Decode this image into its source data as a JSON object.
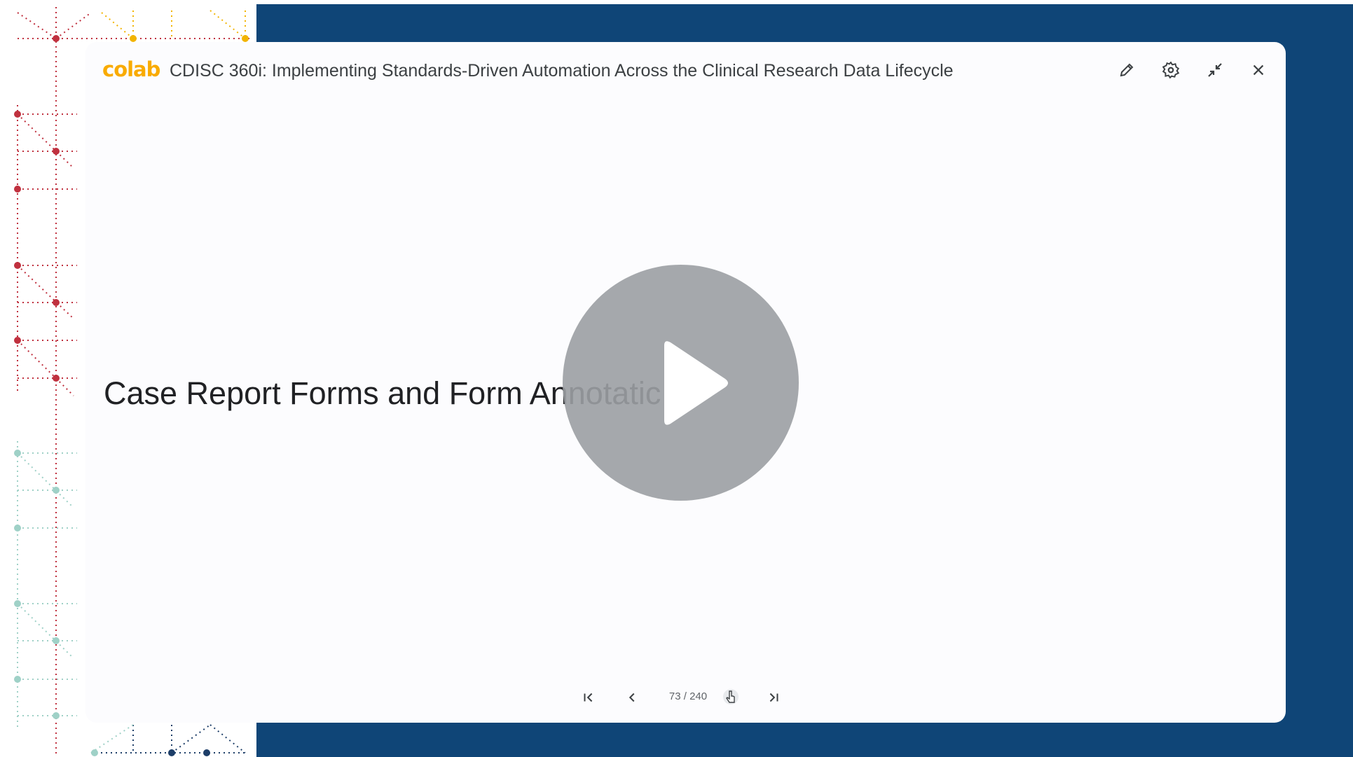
{
  "app": {
    "logo_text": "colab",
    "title": "CDISC 360i: Implementing Standards-Driven Automation Across the Clinical Research Data Lifecycle"
  },
  "toolbar": {
    "icons": [
      "pencil-icon",
      "gear-icon",
      "collapse-icon",
      "close-icon"
    ]
  },
  "slide": {
    "text": "Case Report Forms and Form Annotatic :"
  },
  "player": {
    "icon": "play-icon"
  },
  "navigation": {
    "counter": "73 / 240",
    "icons": [
      "first-slide-icon",
      "prev-slide-icon",
      "hand-cursor-icon",
      "last-slide-icon"
    ]
  },
  "colors": {
    "background_blue": "#0f4577",
    "logo_yellow": "#f9ab00",
    "logo_orange": "#f57c00",
    "decor_red": "#c0313f",
    "decor_yellow": "#f2b400",
    "decor_teal": "#9fd1c7",
    "decor_navy": "#1d3e68"
  }
}
